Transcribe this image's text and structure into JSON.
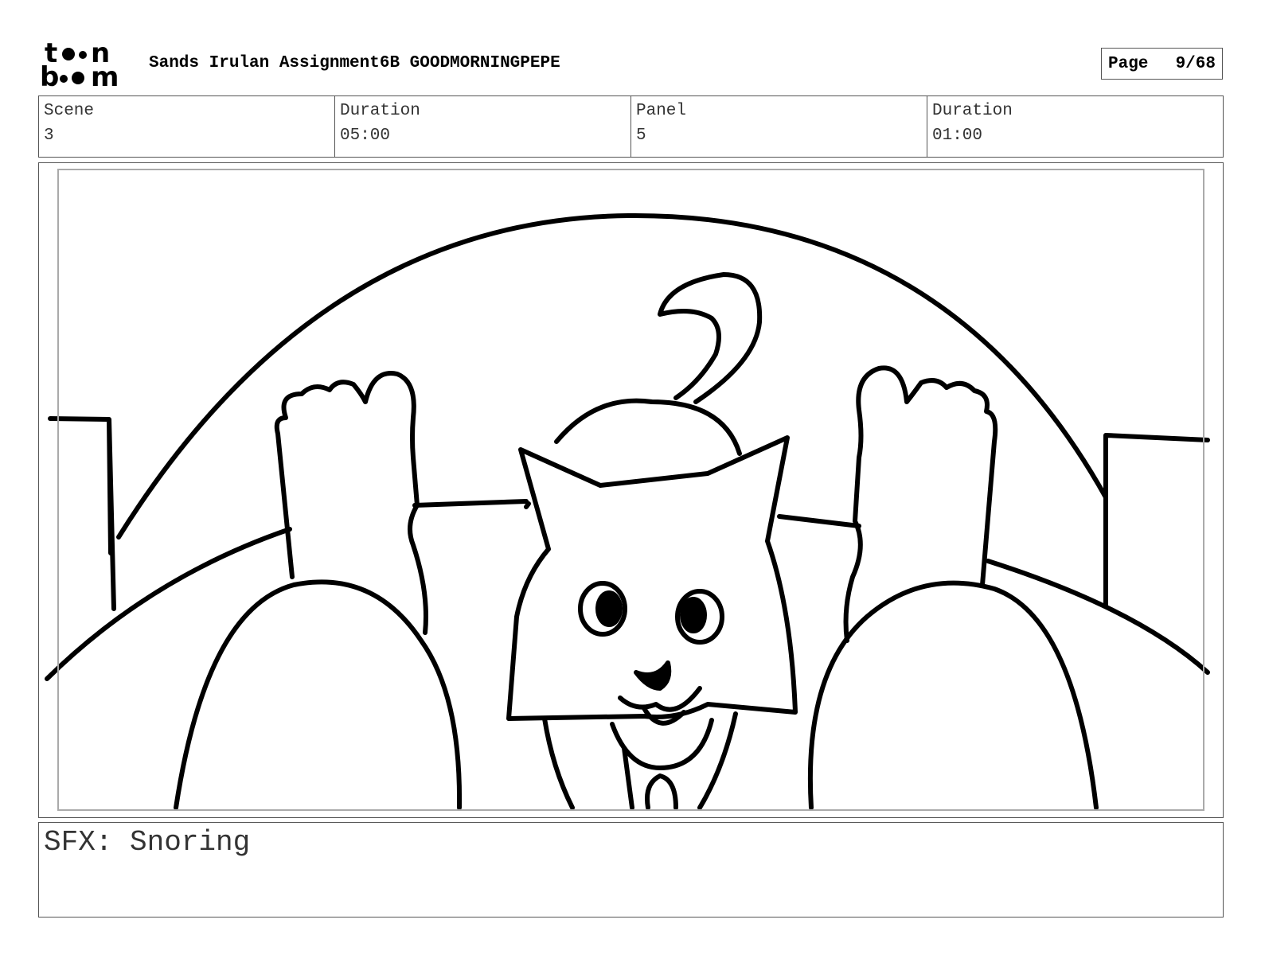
{
  "header": {
    "logo_text": "toon boom",
    "title": "Sands Irulan Assignment6B GOODMORNINGPEPE",
    "page_label": "Page",
    "page_value": "9/68"
  },
  "info": {
    "scene_label": "Scene",
    "scene_value": "3",
    "scene_duration_label": "Duration",
    "scene_duration_value": "05:00",
    "panel_label": "Panel",
    "panel_value": "5",
    "panel_duration_label": "Duration",
    "panel_duration_value": "01:00"
  },
  "notes": {
    "text": "SFX: Snoring"
  }
}
